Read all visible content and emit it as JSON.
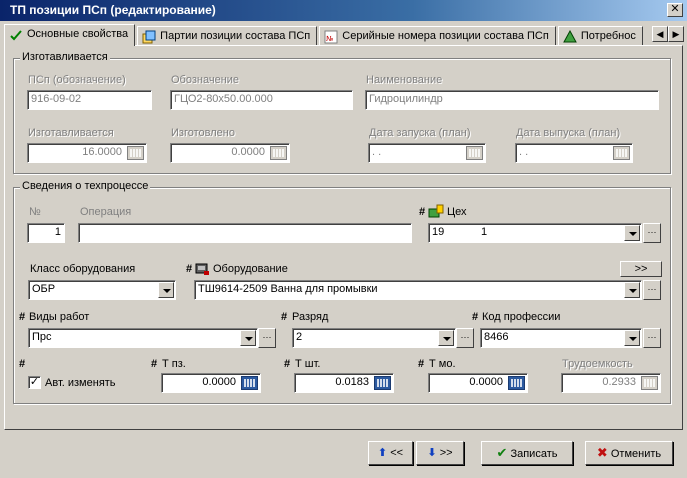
{
  "window": {
    "title": "ТП позиции ПСп (редактирование)"
  },
  "tabs": [
    {
      "label": "Основные свойства"
    },
    {
      "label": "Партии позиции состава ПСп"
    },
    {
      "label": "Серийные номера позиции состава ПСп"
    },
    {
      "label": "Потребнос"
    }
  ],
  "made": {
    "title": "Изготавливается",
    "psp_label": "ПСп (обозначение)",
    "psp_value": "916-09-02",
    "designation_label": "Обозначение",
    "designation_value": "ГЦО2-80x50.00.000",
    "name_label": "Наименование",
    "name_value": "Гидроцилиндр",
    "qty_label": "Изготавливается",
    "qty_value": "16.0000",
    "made_label": "Изготовлено",
    "made_value": "0.0000",
    "start_label": "Дата запуска (план)",
    "start_value": " . .",
    "release_label": "Дата выпуска (план)",
    "release_value": " . ."
  },
  "tech": {
    "title": "Сведения о техпроцессе",
    "num_label": "№",
    "num_value": "1",
    "op_label": "Операция",
    "op_value": "",
    "hash": "#",
    "shop_label": "Цех",
    "shop_code": "19",
    "shop_value": "1",
    "equip_class_label": "Класс оборудования",
    "equip_class_value": "ОБР",
    "equip_label": "Оборудование",
    "equip_value": "ТШ9614-2509  Ванна для промывки",
    "equip_more": ">>",
    "work_label": "Виды работ",
    "work_value": "Прс",
    "grade_label": "Разряд",
    "grade_value": "2",
    "prof_label": "Код профессии",
    "prof_value": "8466",
    "auto_label": "Авт. изменять",
    "tpz_label": "Т пз.",
    "tpz_value": "0.0000",
    "tsht_label": "Т шт.",
    "tsht_value": "0.0183",
    "tmo_label": "Т мо.",
    "tmo_value": "0.0000",
    "labor_label": "Трудоемкость",
    "labor_value": "0.2933"
  },
  "footer": {
    "prev_label": "<<",
    "next_label": ">>",
    "save_label": "Записать",
    "cancel_label": "Отменить"
  }
}
